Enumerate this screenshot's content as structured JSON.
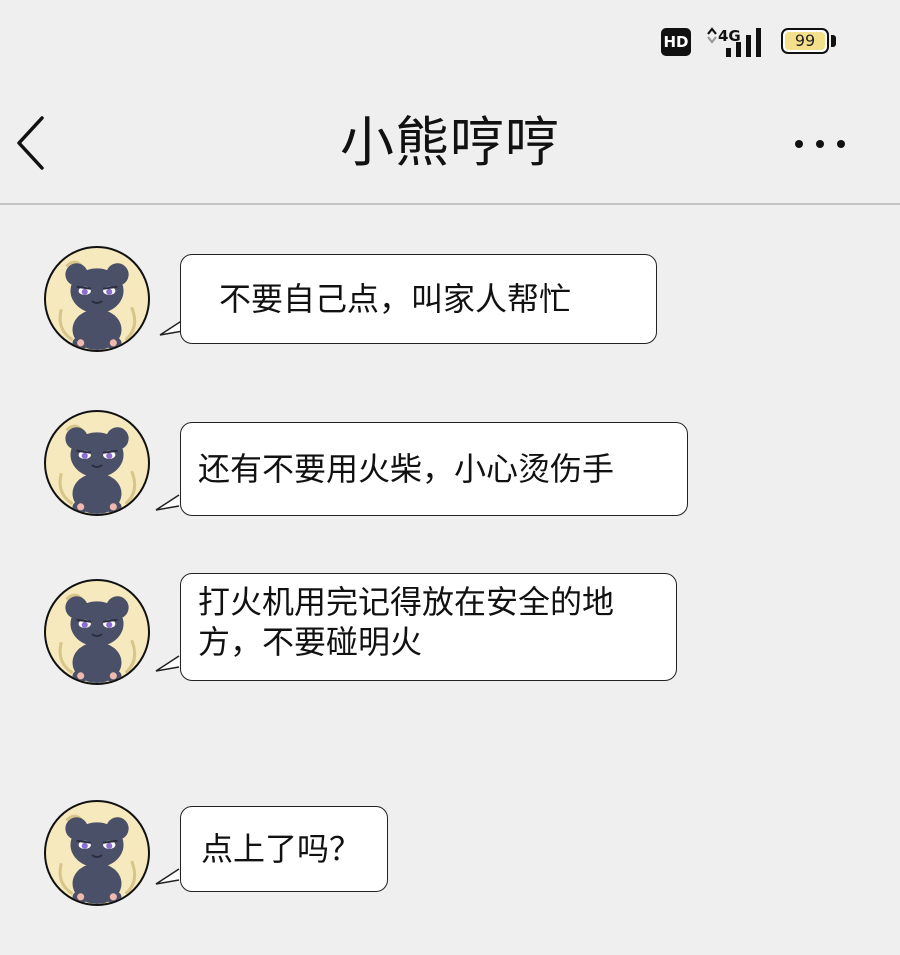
{
  "status_bar": {
    "hd_label": "HD",
    "network_label": "4G",
    "battery_level": "99",
    "battery_fraction": 0.99
  },
  "header": {
    "back_icon": "chevron-left-icon",
    "title": "小熊哼哼",
    "more_icon": "more-horizontal-icon"
  },
  "messages": [
    {
      "sender_avatar": "bear-avatar",
      "text": "不要自己点，叫家人帮忙"
    },
    {
      "sender_avatar": "bear-avatar",
      "text": "还有不要用火柴，小心烫伤手"
    },
    {
      "sender_avatar": "bear-avatar",
      "text": "打火机用完记得放在安全的地方，不要碰明火"
    },
    {
      "sender_avatar": "bear-avatar",
      "text": "点上了吗？"
    }
  ],
  "colors": {
    "background": "#efefef",
    "bubble": "#ffffff",
    "avatar_bg": "#f6e9bd",
    "bear": "#4a5068",
    "bear_eye": "#8a6fd0"
  }
}
